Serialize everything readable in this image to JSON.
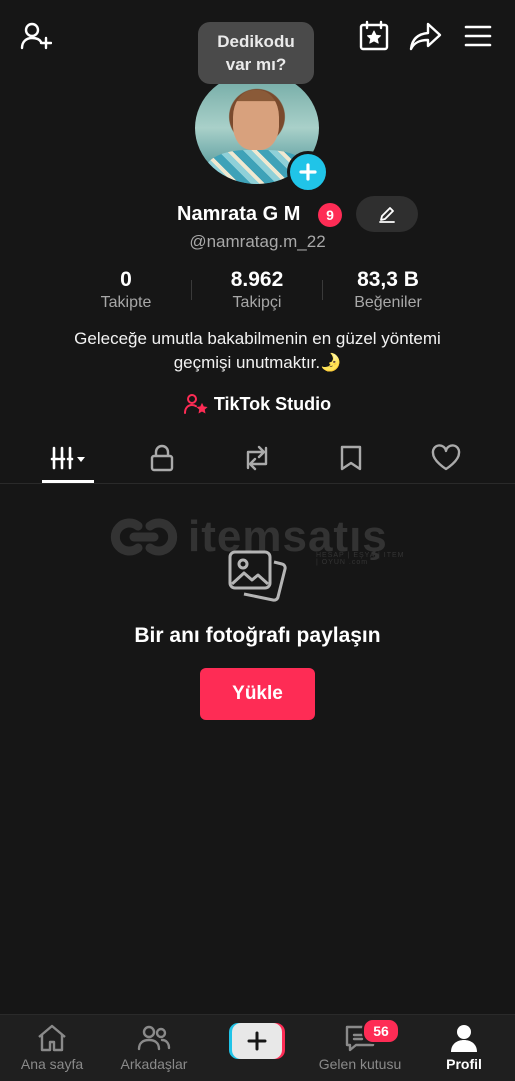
{
  "tooltip": {
    "line1": "Dedikodu",
    "line2": "var mı?"
  },
  "profile": {
    "display_name": "Namrata G M",
    "notification_count": "9",
    "username": "@namratag.m_22",
    "bio_line1": "Geleceğe umutla bakabilmenin en güzel yöntemi",
    "bio_line2": "geçmişi unutmaktır.🌛"
  },
  "stats": {
    "following": {
      "value": "0",
      "label": "Takipte"
    },
    "followers": {
      "value": "8.962",
      "label": "Takipçi"
    },
    "likes": {
      "value": "83,3 B",
      "label": "Beğeniler"
    }
  },
  "studio": {
    "label": "TikTok Studio"
  },
  "tabs": [
    "videos-grid-icon",
    "lock-icon",
    "repost-icon",
    "bookmark-icon",
    "heart-icon"
  ],
  "watermark": {
    "text": "itemsatış",
    "sub": "HESAP | EŞYA | ITEM | OYUN .com"
  },
  "empty_state": {
    "title": "Bir anı fotoğrafı paylaşın",
    "button": "Yükle"
  },
  "bottom_nav": {
    "home": "Ana sayfa",
    "friends": "Arkadaşlar",
    "inbox": "Gelen kutusu",
    "inbox_badge": "56",
    "profile": "Profil"
  },
  "colors": {
    "accent": "#fe2c55",
    "cyan": "#20c4e8",
    "background": "#161616"
  }
}
